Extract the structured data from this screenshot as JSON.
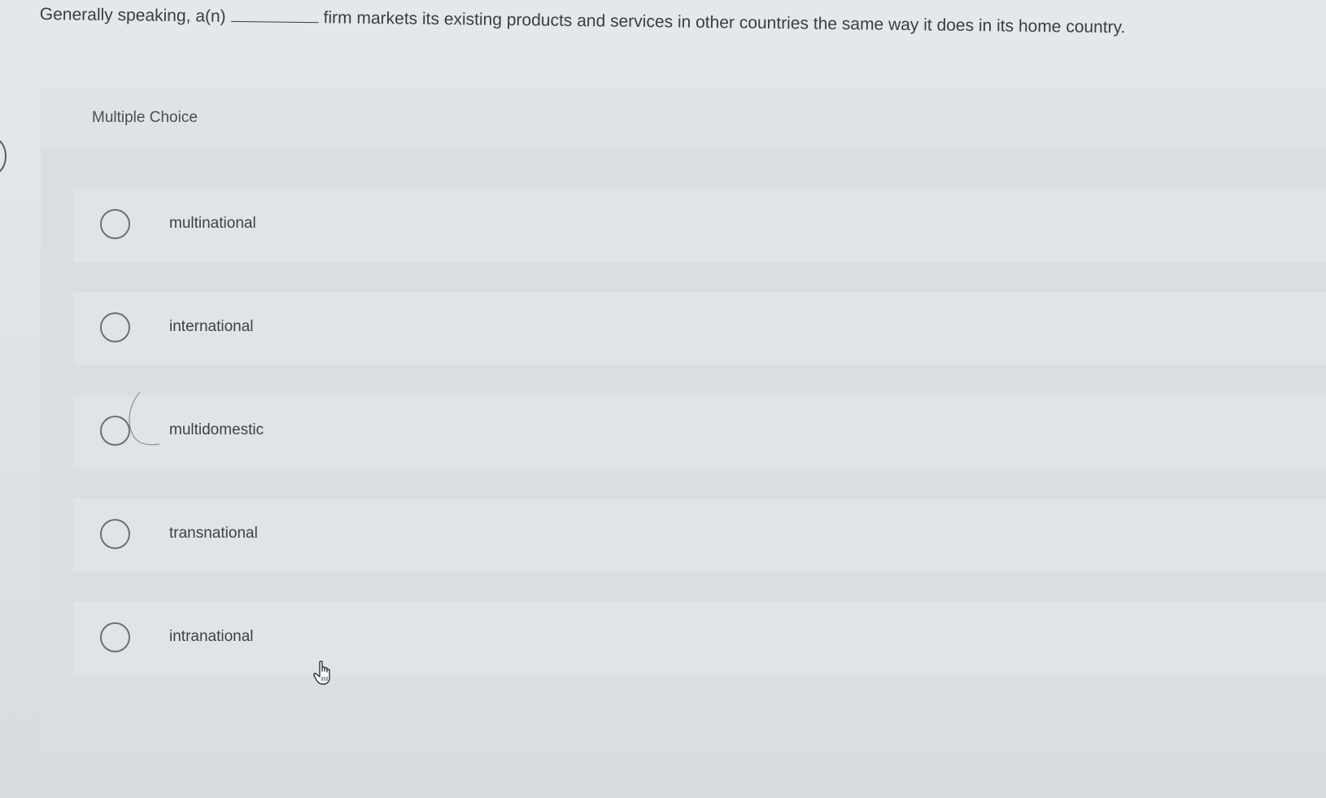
{
  "question": {
    "before_blank": "Generally speaking, a(n)",
    "after_blank": "firm markets its existing products and services in other countries the same way it does in its home country."
  },
  "panel": {
    "title": "Multiple Choice"
  },
  "options": [
    {
      "label": "multinational"
    },
    {
      "label": "international"
    },
    {
      "label": "multidomestic"
    },
    {
      "label": "transnational"
    },
    {
      "label": "intranational"
    }
  ],
  "icons": {
    "cursor": "hand-pointer-icon",
    "radio": "radio-circle-icon"
  },
  "colors": {
    "background": "#dde2e5",
    "panel": "#d9dee1",
    "option_row": "#e0e4e7",
    "text": "#3a3e43",
    "radio_border": "#6c7074"
  }
}
